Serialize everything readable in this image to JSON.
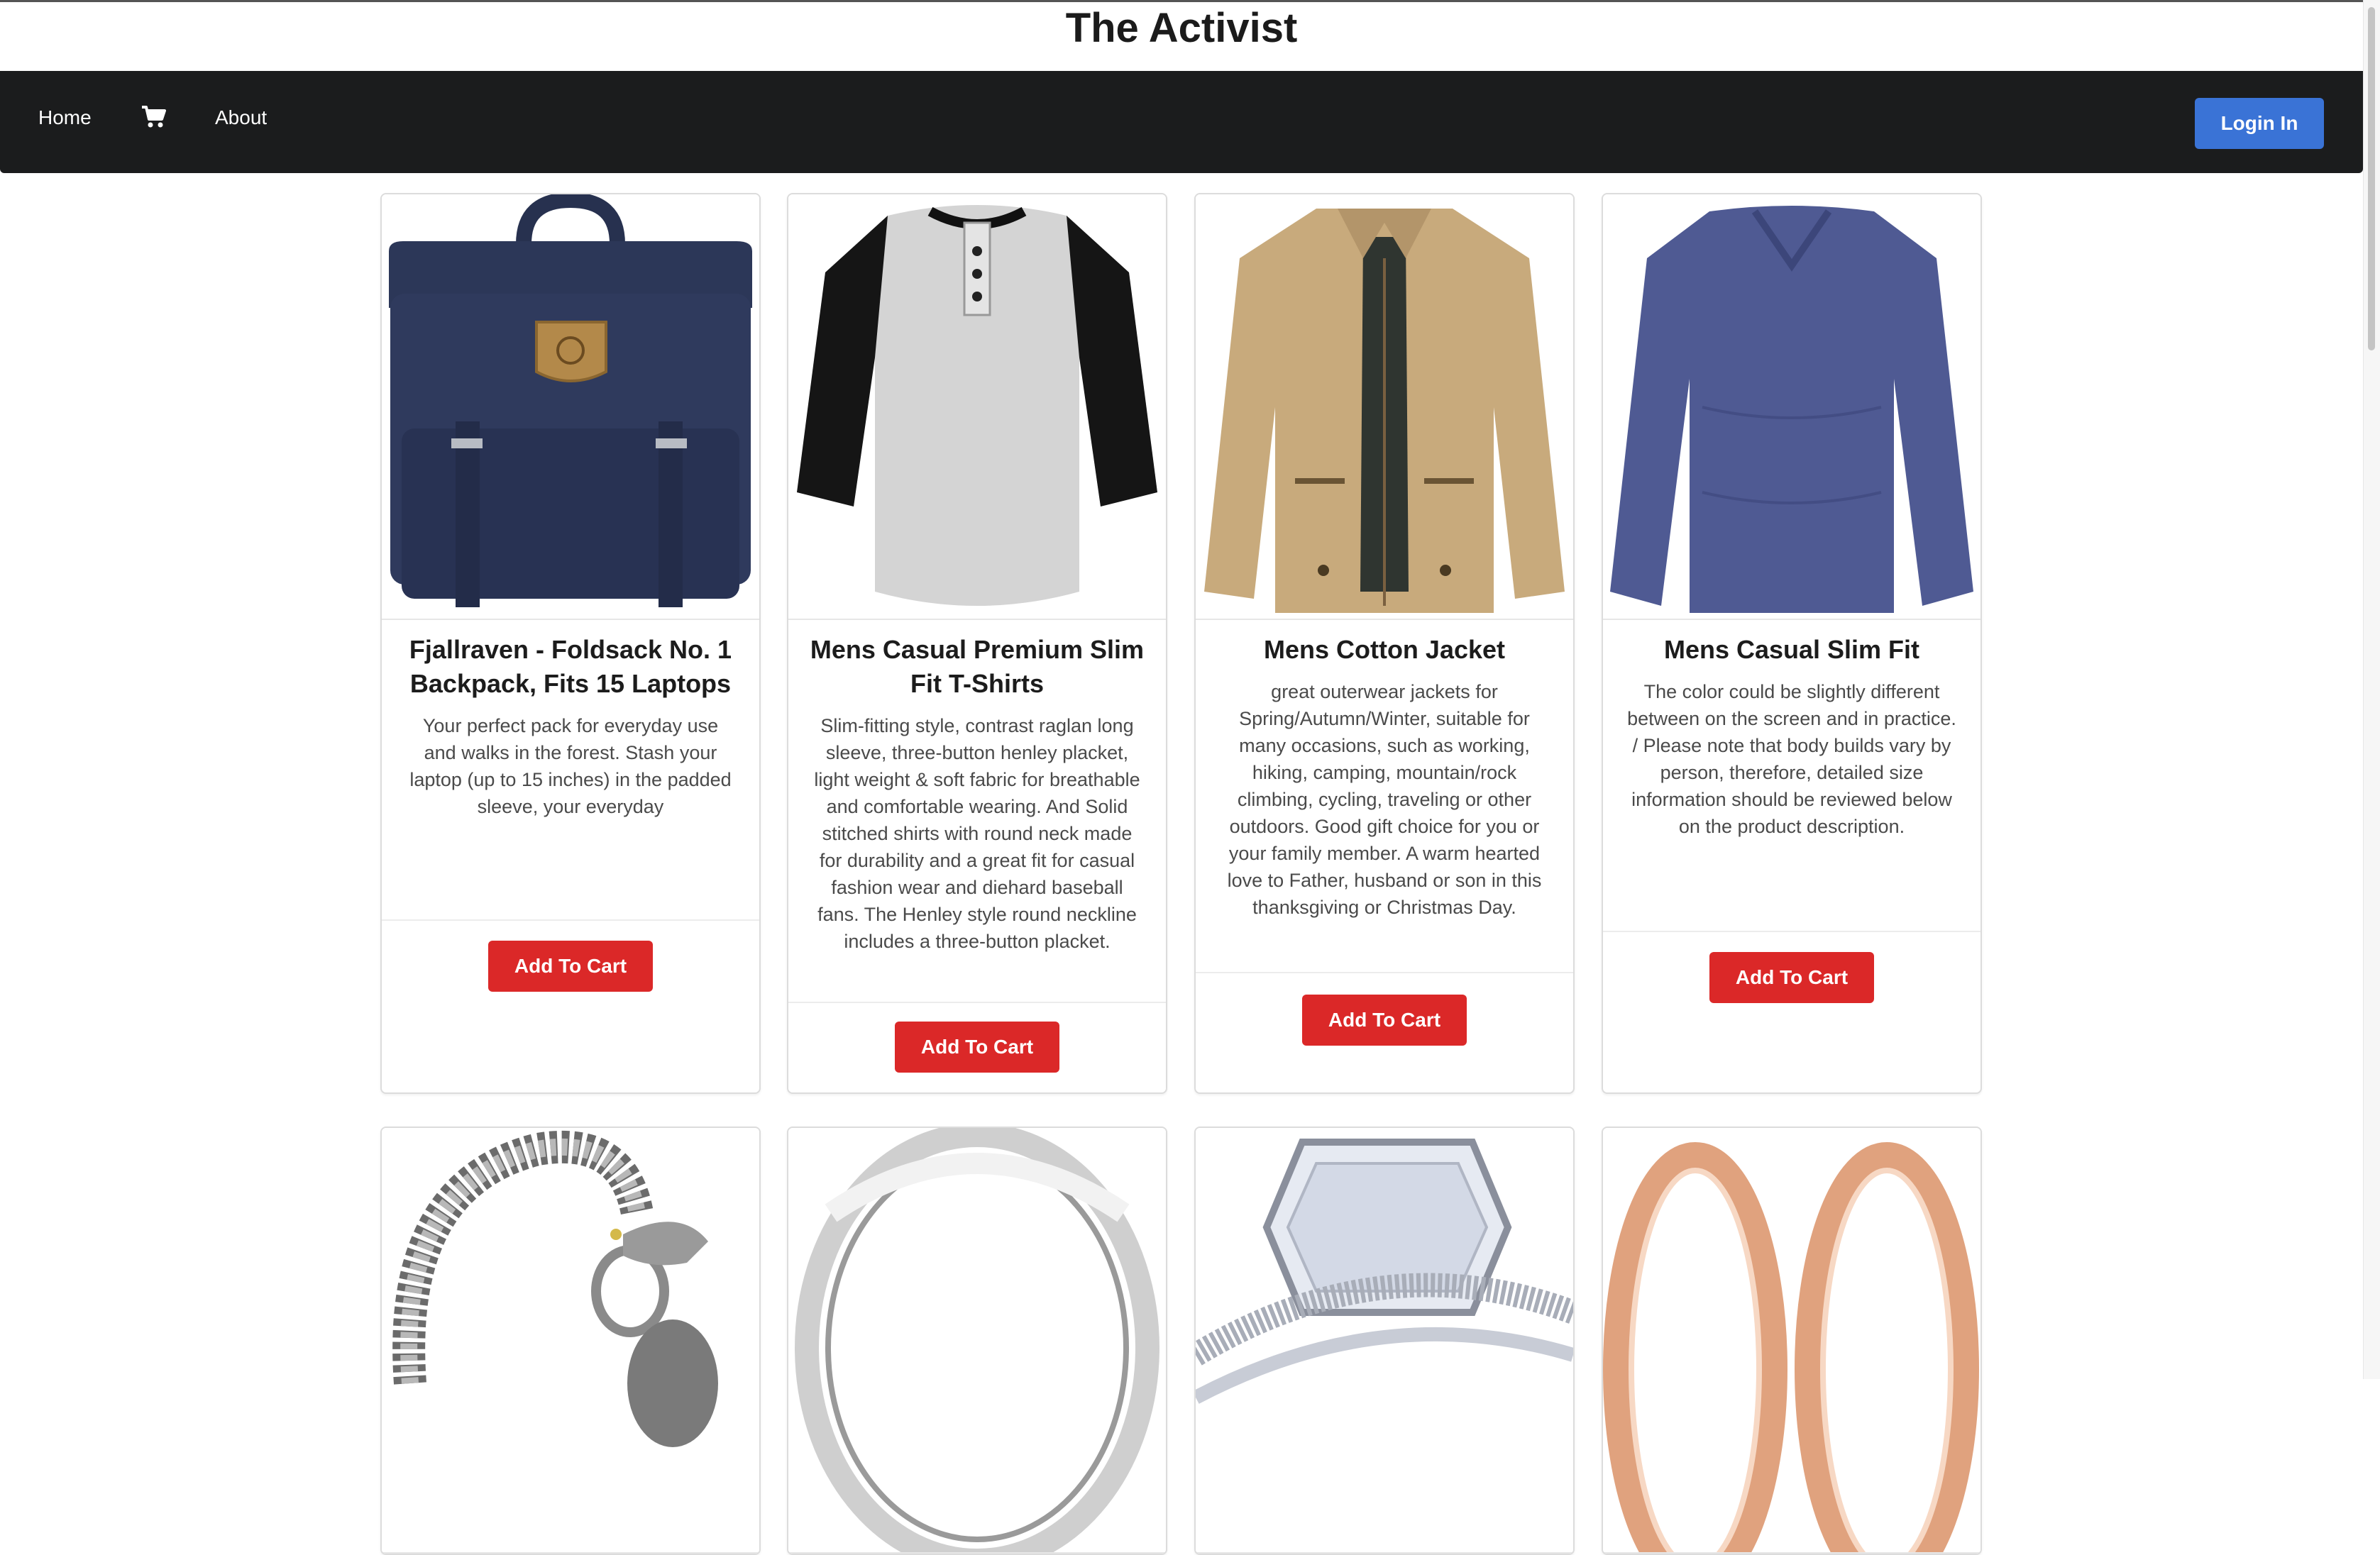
{
  "site": {
    "title": "The Activist"
  },
  "nav": {
    "home": "Home",
    "cart_icon": "shopping-cart-icon",
    "about": "About",
    "login": "Login In"
  },
  "colors": {
    "navbar": "#1b1c1d",
    "login": "#3a73d6",
    "add_to_cart": "#db2828"
  },
  "products": [
    {
      "title": "Fjallraven - Foldsack No. 1 Backpack, Fits 15 Laptops",
      "description": "Your perfect pack for everyday use and walks in the forest. Stash your laptop (up to 15 inches) in the padded sleeve, your everyday",
      "button": "Add To Cart",
      "image": "navy-backpack"
    },
    {
      "title": "Mens Casual Premium Slim Fit T-Shirts",
      "description": "Slim-fitting style, contrast raglan long sleeve, three-button henley placket, light weight & soft fabric for breathable and comfortable wearing. And Solid stitched shirts with round neck made for durability and a great fit for casual fashion wear and diehard baseball fans. The Henley style round neckline includes a three-button placket.",
      "button": "Add To Cart",
      "image": "raglan-henley-shirt"
    },
    {
      "title": "Mens Cotton Jacket",
      "description": "great outerwear jackets for Spring/Autumn/Winter, suitable for many occasions, such as working, hiking, camping, mountain/rock climbing, cycling, traveling or other outdoors. Good gift choice for you or your family member. A warm hearted love to Father, husband or son in this thanksgiving or Christmas Day.",
      "button": "Add To Cart",
      "image": "khaki-jacket"
    },
    {
      "title": "Mens Casual Slim Fit",
      "description": "The color could be slightly different between on the screen and in practice. / Please note that body builds vary by person, therefore, detailed size information should be reviewed below on the product description.",
      "button": "Add To Cart",
      "image": "blue-long-sleeve-shirt"
    },
    {
      "image": "dragon-chain-bracelet"
    },
    {
      "image": "silver-ring"
    },
    {
      "image": "diamond-ring-set"
    },
    {
      "image": "rose-gold-rings"
    }
  ]
}
